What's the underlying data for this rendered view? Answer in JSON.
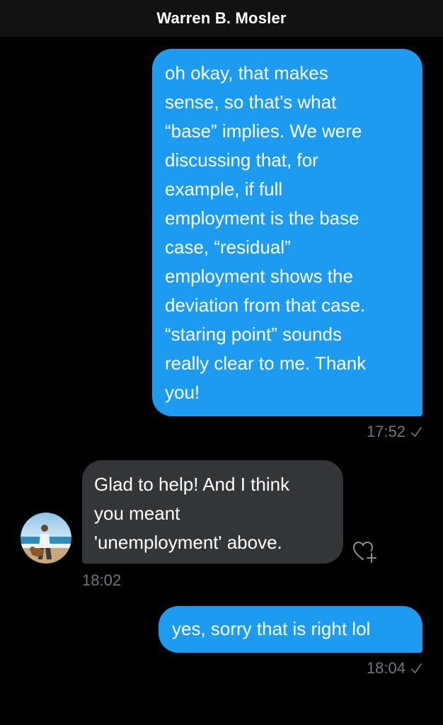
{
  "header": {
    "title": "Warren B. Mosler"
  },
  "messages": [
    {
      "direction": "outgoing",
      "text": "oh okay, that makes\nsense, so that’s what\n“base” implies. We were\ndiscussing that, for\nexample, if full\nemployment is the base\ncase, “residual”\nemployment shows the\ndeviation from that case.\n“staring point” sounds\nreally clear to me. Thank\nyou!",
      "time": "17:52",
      "status_icon": "sent-check-icon"
    },
    {
      "direction": "incoming",
      "text": "Glad to help! And I think\nyou meant\n'unemployment' above.",
      "time": "18:02",
      "avatar": "contact-avatar",
      "reaction_icon": "add-reaction-heart-icon"
    },
    {
      "direction": "outgoing",
      "text": "yes, sorry that is right lol",
      "time": "18:04",
      "status_icon": "sent-check-icon"
    }
  ],
  "colors": {
    "background": "#000000",
    "header_background": "#121212",
    "outgoing_bubble": "#1d9bf0",
    "incoming_bubble": "#333537",
    "timestamp": "#71767b"
  }
}
